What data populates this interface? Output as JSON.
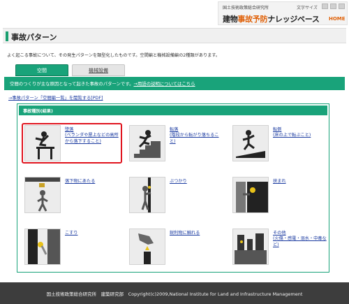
{
  "header": {
    "org": "国土技術政策総合研究所",
    "font_size_label": "文字サイズ",
    "brand_prefix": "建物",
    "brand_accent": "事故予防",
    "brand_suffix": "ナレッジベース",
    "home": "HOME"
  },
  "page": {
    "title": "事故パターン",
    "intro": "よく起こる事故について、その発生パターンを類型化したものです。空間編と機械設備編の2種類があります。"
  },
  "tabs": [
    {
      "label": "空間",
      "active": true
    },
    {
      "label": "機械設備",
      "active": false
    }
  ],
  "band": {
    "text": "空間のつくりが主な原因となって起きた事故のパターンです。",
    "link": "→用語の説明についてはこちら"
  },
  "pdf_link": "→事故パターン「空間編一覧」を閲覧する[PDF]",
  "types": {
    "header": "事故種別(結果)",
    "items": [
      {
        "label": "墜落\n(ベランダや屋上などの高所から落下すること)",
        "icon": "fall-from-height-icon"
      },
      {
        "label": "転落\n(階段から転がり落ちること)",
        "icon": "fall-down-stairs-icon"
      },
      {
        "label": "転倒\n(床の上で転ぶこと)",
        "icon": "slip-fall-icon"
      },
      {
        "label": "落下物にあたる",
        "icon": "falling-object-icon"
      },
      {
        "label": "ぶつかり",
        "icon": "collision-icon"
      },
      {
        "label": "挟まれ",
        "icon": "caught-in-door-icon"
      },
      {
        "label": "こすり",
        "icon": "scrape-icon"
      },
      {
        "label": "鋭利物に触れる",
        "icon": "sharp-object-icon"
      },
      {
        "label": "その他\n(火傷・感電・溺水・中毒など)",
        "icon": "other-hazards-icon"
      }
    ]
  },
  "footer": "国土技術政策総合研究所　建築研究部　Copyright(c)2009,National Institute for Land and Infrastructure Management",
  "colors": {
    "accent": "#19a37a",
    "brand_orange": "#e0620a",
    "link": "#1a3aa0",
    "highlight": "#e0141e",
    "footer_bg": "#3d3d3d"
  }
}
